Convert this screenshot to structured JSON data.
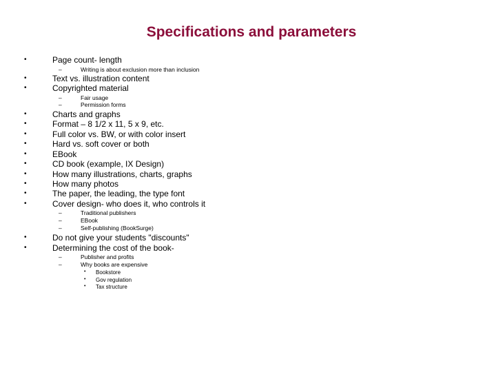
{
  "title": "Specifications and parameters",
  "accent_color": "#8b0e3a",
  "bullet_glyph": "•",
  "dash_glyph": "–",
  "items": [
    {
      "text": "Page count- length"
    },
    {
      "text": "Writing is about exclusion more than inclusion"
    },
    {
      "text": "Text vs. illustration content"
    },
    {
      "text": "Copyrighted material"
    },
    {
      "text": "Fair usage"
    },
    {
      "text": "Permission forms"
    },
    {
      "text": "Charts and graphs"
    },
    {
      "text": "Format – 8 1/2 x 11,   5 x 9, etc."
    },
    {
      "text": "Full color vs. BW, or with color insert"
    },
    {
      "text": "Hard vs. soft cover or both"
    },
    {
      "text": "EBook"
    },
    {
      "text": "CD book (example, IX Design)"
    },
    {
      "text": "How many illustrations, charts, graphs"
    },
    {
      "text": "How many photos"
    },
    {
      "text": "The paper, the leading, the type font"
    },
    {
      "text": "Cover design- who does it, who controls it"
    },
    {
      "text": "Traditional publishers"
    },
    {
      "text": "EBook"
    },
    {
      "text": "Self-publishing (BookSurge)"
    },
    {
      "text": "Do not give your students \"discounts\""
    },
    {
      "text": "Determining the cost of the book-"
    },
    {
      "text": "Publisher and profits"
    },
    {
      "text": "Why books are expensive"
    },
    {
      "text": "Bookstore"
    },
    {
      "text": "Gov regulation"
    },
    {
      "text": "Tax structure"
    }
  ]
}
